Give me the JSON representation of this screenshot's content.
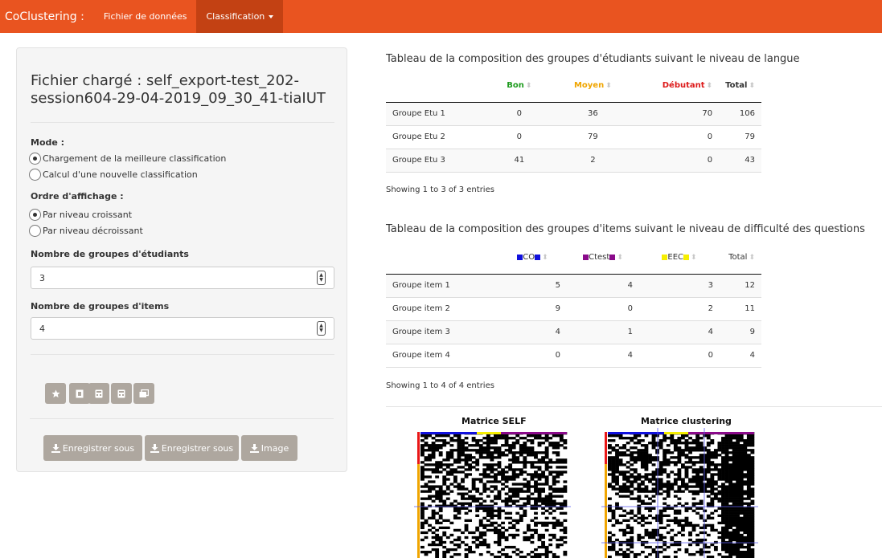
{
  "navbar": {
    "brand": "CoClustering :",
    "items": [
      {
        "label": "Fichier de données",
        "active": false
      },
      {
        "label": "Classification",
        "active": true,
        "dropdown": true
      }
    ],
    "color": "#e95420",
    "active_color": "#c34113"
  },
  "sidebar": {
    "file_title": "Fichier chargé : self_export-test_202-session604-29-04-2019_09_30_41-tiaIUT",
    "mode_label": "Mode :",
    "mode_options": [
      {
        "label": "Chargement de la meilleure classification",
        "checked": true
      },
      {
        "label": "Calcul d'une nouvelle classification",
        "checked": false
      }
    ],
    "order_label": "Ordre d'affichage :",
    "order_options": [
      {
        "label": "Par niveau croissant",
        "checked": true
      },
      {
        "label": "Par niveau décroissant",
        "checked": false
      }
    ],
    "students_groups_label": "Nombre de groupes d'étudiants",
    "students_groups_value": "3",
    "items_groups_label": "Nombre de groupes d'items",
    "items_groups_value": "4",
    "icon_buttons": [
      "star-icon",
      "file-icon",
      "calculator-icon",
      "calculator-icon",
      "images-icon"
    ],
    "download_buttons": [
      "Enregistrer sous",
      "Enregistrer sous",
      "Image"
    ],
    "button_color": "#aea79f"
  },
  "students_table": {
    "title": "Tableau de la composition des groupes d'étudiants suivant le niveau de langue",
    "columns": [
      {
        "label": "",
        "color": null
      },
      {
        "label": "Bon",
        "color": "#1e9b1e"
      },
      {
        "label": "Moyen",
        "color": "#f0a500"
      },
      {
        "label": "Débutant",
        "color": "#dd1a1a"
      },
      {
        "label": "Total",
        "color": "#333333"
      }
    ],
    "rows": [
      [
        "Groupe Etu 1",
        "0",
        "36",
        "70",
        "106"
      ],
      [
        "Groupe Etu 2",
        "0",
        "79",
        "0",
        "79"
      ],
      [
        "Groupe Etu 3",
        "41",
        "2",
        "0",
        "43"
      ]
    ],
    "info": "Showing 1 to 3 of 3 entries"
  },
  "items_table": {
    "title": "Tableau de la composition des groupes d'items suivant le niveau de difficulté des questions",
    "columns": [
      {
        "label": "",
        "square": null
      },
      {
        "label": "CO",
        "square": "#1010dd"
      },
      {
        "label": "Ctest",
        "square": "#8a0a8a"
      },
      {
        "label": "EEC",
        "square": "#f6ee00"
      },
      {
        "label": "Total",
        "square": null
      }
    ],
    "rows": [
      [
        "Groupe item 1",
        "5",
        "4",
        "3",
        "12"
      ],
      [
        "Groupe item 2",
        "9",
        "0",
        "2",
        "11"
      ],
      [
        "Groupe item 3",
        "4",
        "1",
        "4",
        "9"
      ],
      [
        "Groupe item 4",
        "0",
        "4",
        "0",
        "4"
      ]
    ],
    "info": "Showing 1 to 4 of 4 entries"
  },
  "matrices": {
    "left_title": "Matrice SELF",
    "right_title": "Matrice clustering"
  }
}
